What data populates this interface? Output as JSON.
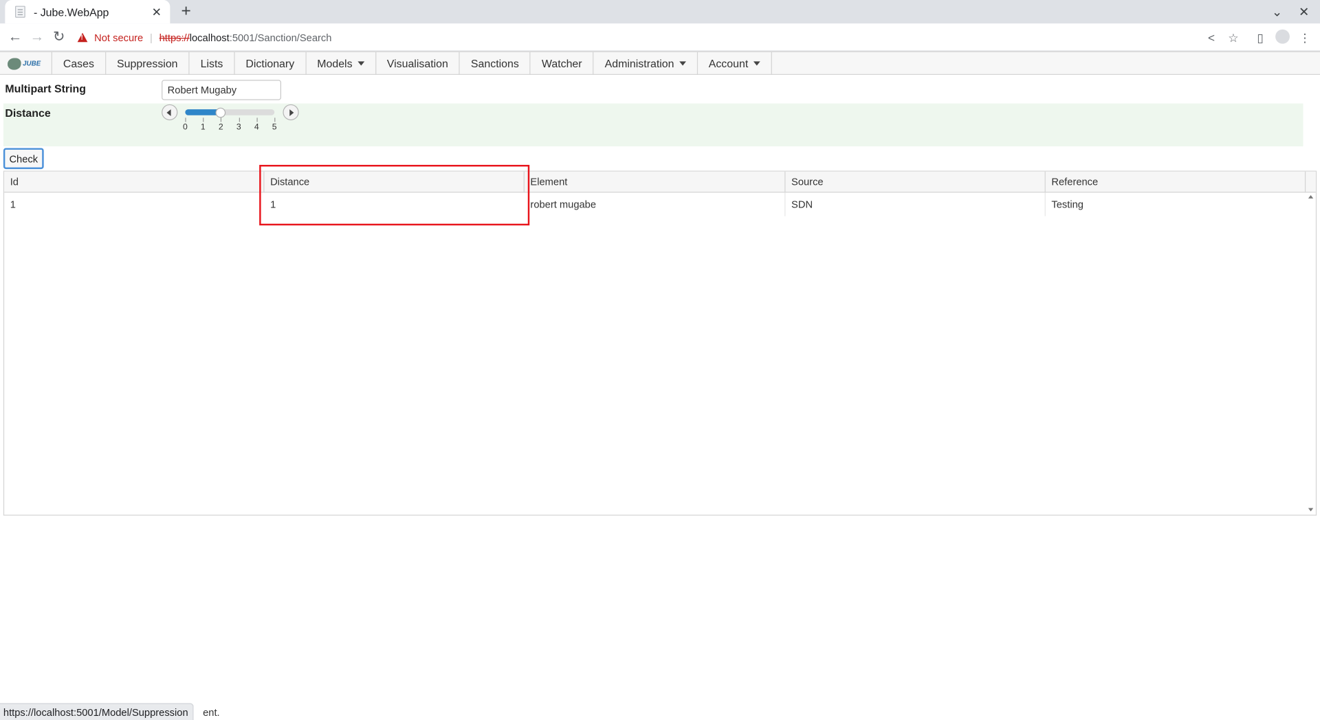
{
  "browser": {
    "tab_title": "- Jube.WebApp",
    "tab_close": "✕",
    "new_tab": "+",
    "window_minimize": "⌄",
    "window_close": "✕",
    "security_label": "Not secure",
    "url_scheme": "https://",
    "url_host": "localhost",
    "url_path": ":5001/Sanction/Search"
  },
  "nav": {
    "logo_text": "JUBE",
    "items": [
      {
        "label": "Cases",
        "dropdown": false
      },
      {
        "label": "Suppression",
        "dropdown": false
      },
      {
        "label": "Lists",
        "dropdown": false
      },
      {
        "label": "Dictionary",
        "dropdown": false
      },
      {
        "label": "Models",
        "dropdown": true
      },
      {
        "label": "Visualisation",
        "dropdown": false
      },
      {
        "label": "Sanctions",
        "dropdown": false
      },
      {
        "label": "Watcher",
        "dropdown": false
      },
      {
        "label": "Administration",
        "dropdown": true
      },
      {
        "label": "Account",
        "dropdown": true
      }
    ]
  },
  "form": {
    "multipart_label": "Multipart String",
    "multipart_value": "Robert Mugaby",
    "distance_label": "Distance",
    "slider": {
      "min": 0,
      "max": 5,
      "value": 2,
      "ticks": [
        "0",
        "1",
        "2",
        "3",
        "4",
        "5"
      ]
    },
    "check_label": "Check"
  },
  "grid": {
    "columns": [
      "Id",
      "Distance",
      "Element",
      "Source",
      "Reference"
    ],
    "rows": [
      [
        "1",
        "1",
        "robert mugabe",
        "SDN",
        "Testing"
      ]
    ]
  },
  "status": {
    "link_url": "https://localhost:5001/Model/Suppression",
    "trailing_text": "ent."
  },
  "colors": {
    "highlight": "#e8141b",
    "slider_fill": "#2f86c9",
    "distance_row_bg": "#eef7ee"
  }
}
